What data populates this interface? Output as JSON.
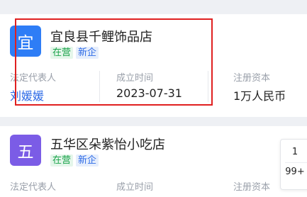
{
  "companies": [
    {
      "logo_char": "宜",
      "logo_color": "#2e7df6",
      "name": "宜良县千鲤饰品店",
      "tags": [
        "在营",
        "新企"
      ],
      "legal_rep_label": "法定代表人",
      "legal_rep": "刘媛媛",
      "established_label": "成立时间",
      "established": "2023-07-31",
      "capital_label": "注册资本",
      "capital": "1万人民币"
    },
    {
      "logo_char": "五",
      "logo_color": "#7b5ce6",
      "name": "五华区朵紫怡小吃店",
      "tags": [
        "在营",
        "新企"
      ],
      "legal_rep_label": "法定代表人",
      "established_label": "成立时间",
      "capital_label": "注册资本"
    }
  ],
  "pager": {
    "current": "1",
    "total": "99+"
  },
  "colors": {
    "highlight": "#e02020",
    "tag_green": "#1aa34a",
    "tag_blue": "#2e6be6"
  }
}
